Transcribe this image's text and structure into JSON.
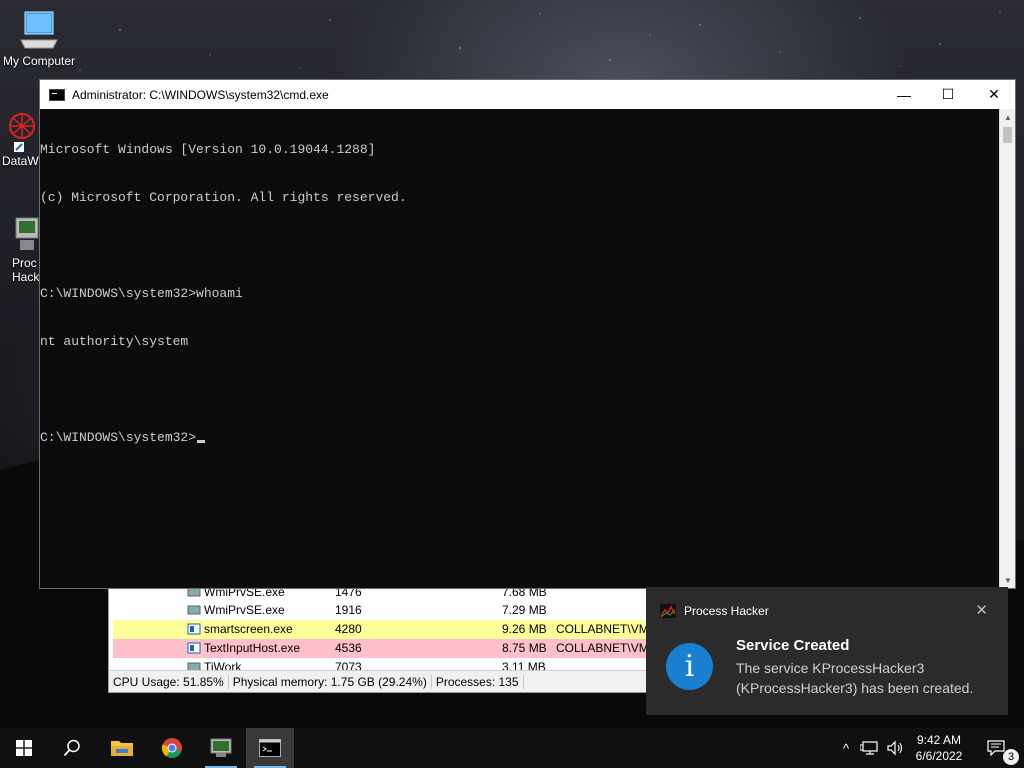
{
  "desktop": {
    "icons": [
      {
        "label": "My Computer"
      },
      {
        "label": "DataW"
      },
      {
        "label": "Proc"
      },
      {
        "label": "Hack"
      }
    ]
  },
  "cmd": {
    "title": "Administrator: C:\\WINDOWS\\system32\\cmd.exe",
    "controls": {
      "minimize": "—",
      "maximize": "☐",
      "close": "✕"
    },
    "lines": [
      "Microsoft Windows [Version 10.0.19044.1288]",
      "(c) Microsoft Corporation. All rights reserved.",
      "",
      "C:\\WINDOWS\\system32>whoami",
      "nt authority\\system",
      "",
      "C:\\WINDOWS\\system32>"
    ]
  },
  "process_hacker": {
    "rows": [
      {
        "name": "WmiPrvSE.exe",
        "pid": "1476",
        "memory": "7.68 MB",
        "user": ""
      },
      {
        "name": "WmiPrvSE.exe",
        "pid": "1916",
        "memory": "7.29 MB",
        "user": ""
      },
      {
        "name": "smartscreen.exe",
        "pid": "4280",
        "memory": "9.26 MB",
        "user": "COLLABNET\\VM"
      },
      {
        "name": "TextInputHost.exe",
        "pid": "4536",
        "memory": "8.75 MB",
        "user": "COLLABNET\\VM"
      },
      {
        "name": "TiWork",
        "pid": "7073",
        "memory": "3.11 MB",
        "user": ""
      }
    ],
    "status": {
      "cpu": "CPU Usage: 51.85%",
      "memory": "Physical memory: 1.75 GB (29.24%)",
      "processes": "Processes: 135"
    }
  },
  "toast": {
    "app": "Process Hacker",
    "close": "✕",
    "icon_glyph": "i",
    "title": "Service Created",
    "message": "The service KProcessHacker3 (KProcessHacker3) has been created."
  },
  "taskbar": {
    "clock_time": "9:42 AM",
    "clock_date": "6/6/2022",
    "notification_count": "3",
    "tray_chevron": "^"
  },
  "colors": {
    "cmd_bg": "#0c0c0c",
    "cmd_text": "#cccccc",
    "row_yellow": "#ffff99",
    "row_pink": "#ffc0cb",
    "toast_bg": "#2b2b2b",
    "info_blue": "#1a7fd0",
    "taskbar_bg": "#101010"
  }
}
